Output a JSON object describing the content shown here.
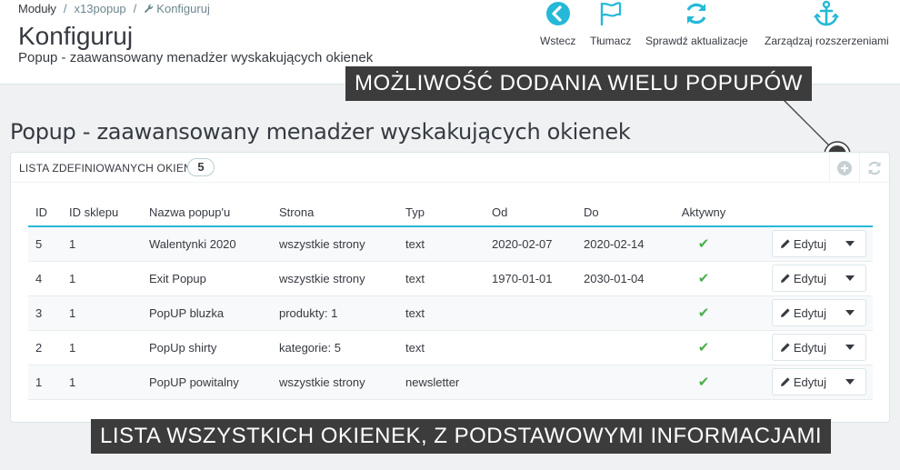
{
  "breadcrumb": {
    "level1": "Moduły",
    "level2": "x13popup",
    "level3": "Konfiguruj"
  },
  "page": {
    "title": "Konfiguruj",
    "subtitle": "Popup - zaawansowany menadżer wyskakujących okienek"
  },
  "toolbar": {
    "back": "Wstecz",
    "translate": "Tłumacz",
    "check_updates": "Sprawdź aktualizacje",
    "manage_extensions": "Zarządzaj rozszerzeniami"
  },
  "callouts": {
    "top": "MOŻLIWOŚĆ DODANIA WIELU POPUPÓW",
    "bottom": "LISTA WSZYSTKICH OKIENEK, Z PODSTAWOWYMI INFORMACJAMI"
  },
  "section_title": "Popup - zaawansowany menadżer wyskakujących okienek",
  "panel": {
    "title": "Lista zdefiniowanych okienek",
    "count": "5"
  },
  "table": {
    "headers": [
      "ID",
      "ID sklepu",
      "Nazwa popup'u",
      "Strona",
      "Typ",
      "Od",
      "Do",
      "Aktywny"
    ],
    "edit_label": "Edytuj",
    "rows": [
      {
        "id": "5",
        "shop": "1",
        "name": "Walentynki 2020",
        "page": "wszystkie strony",
        "type": "text",
        "from": "2020-02-07",
        "to": "2020-02-14"
      },
      {
        "id": "4",
        "shop": "1",
        "name": "Exit Popup",
        "page": "wszystkie strony",
        "type": "text",
        "from": "1970-01-01",
        "to": "2030-01-04"
      },
      {
        "id": "3",
        "shop": "1",
        "name": "PopUP bluzka",
        "page": "produkty: 1",
        "type": "text",
        "from": "",
        "to": ""
      },
      {
        "id": "2",
        "shop": "1",
        "name": "PopUp shirty",
        "page": "kategorie: 5",
        "type": "text",
        "from": "",
        "to": ""
      },
      {
        "id": "1",
        "shop": "1",
        "name": "PopUP powitalny",
        "page": "wszystkie strony",
        "type": "newsletter",
        "from": "",
        "to": ""
      }
    ]
  },
  "icons": {
    "back": "arrow-left-circle-icon",
    "translate": "flag-icon",
    "check_updates": "refresh-icon",
    "manage_extensions": "anchor-icon",
    "add": "plus-circle-icon",
    "refresh_list": "refresh-icon",
    "active": "check-icon",
    "edit": "pencil-icon",
    "dropdown": "caret-down-icon"
  },
  "colors": {
    "accent": "#25b9d7",
    "success": "#4cae4c",
    "callout_bg": "#3c3c3c"
  }
}
